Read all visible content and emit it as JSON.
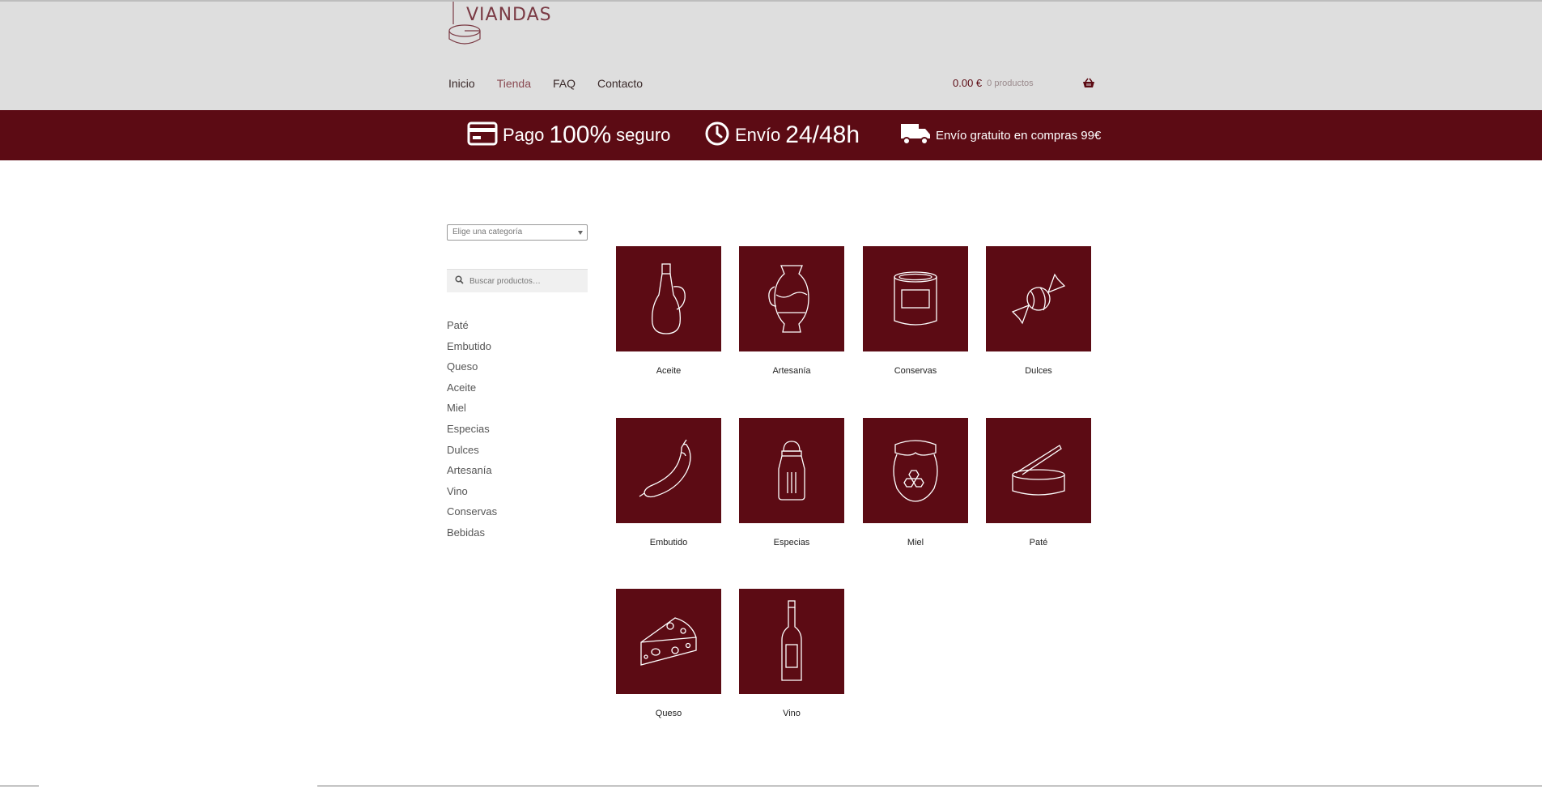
{
  "brand": {
    "logo_text": "VIANDAS"
  },
  "nav": {
    "items": [
      "Inicio",
      "Tienda",
      "FAQ",
      "Contacto"
    ],
    "active": "Tienda"
  },
  "cart": {
    "amount": "0.00 €",
    "count": "0 productos"
  },
  "banner": {
    "payment": {
      "pre": "Pago",
      "big": "100%",
      "post": "seguro"
    },
    "shipping": {
      "pre": "Envío",
      "big": "24/48h"
    },
    "free": {
      "text": "Envío gratuito en compras 99€"
    }
  },
  "sidebar": {
    "category_select": "Elige una categoría",
    "search_placeholder": "Buscar productos…",
    "categories": [
      "Paté",
      "Embutido",
      "Queso",
      "Aceite",
      "Miel",
      "Especias",
      "Dulces",
      "Artesanía",
      "Vino",
      "Conservas",
      "Bebidas"
    ]
  },
  "products": [
    {
      "label": "Aceite",
      "icon": "oil-bottle-icon"
    },
    {
      "label": "Artesanía",
      "icon": "jug-icon"
    },
    {
      "label": "Conservas",
      "icon": "can-icon"
    },
    {
      "label": "Dulces",
      "icon": "candy-icon"
    },
    {
      "label": "Embutido",
      "icon": "sausage-icon"
    },
    {
      "label": "Especias",
      "icon": "salt-shaker-icon"
    },
    {
      "label": "Miel",
      "icon": "honey-jar-icon"
    },
    {
      "label": "Paté",
      "icon": "pate-tin-icon"
    },
    {
      "label": "Queso",
      "icon": "cheese-icon"
    },
    {
      "label": "Vino",
      "icon": "wine-bottle-icon"
    }
  ],
  "colors": {
    "brand": "#5c0b14",
    "header_bg": "#dedede"
  }
}
